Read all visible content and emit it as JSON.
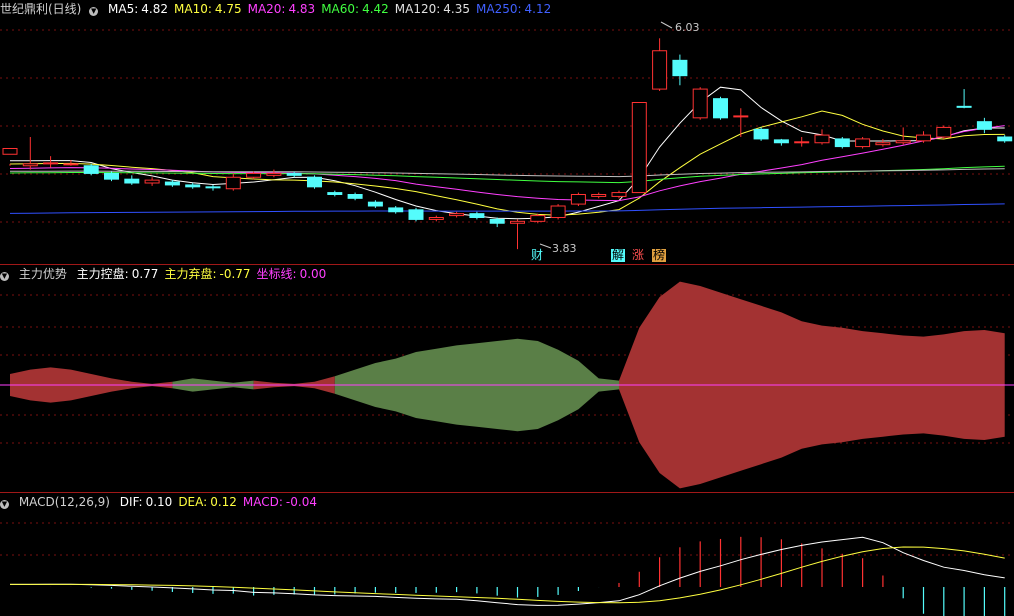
{
  "main_panel": {
    "title": "世纪鼎利(日线)",
    "ma": [
      {
        "label": "MA5:",
        "value": "4.82",
        "color": "#ffffff"
      },
      {
        "label": "MA10:",
        "value": "4.75",
        "color": "#ffff40"
      },
      {
        "label": "MA20:",
        "value": "4.83",
        "color": "#ff40ff"
      },
      {
        "label": "MA60:",
        "value": "4.42",
        "color": "#40ff40"
      },
      {
        "label": "MA120:",
        "value": "4.35",
        "color": "#e0e0e0"
      },
      {
        "label": "MA250:",
        "value": "4.12",
        "color": "#4060ff"
      }
    ],
    "high_label": "6.03",
    "low_label": "3.83",
    "markers": [
      "财",
      "解",
      "涨",
      "榜"
    ]
  },
  "indicator_panel": {
    "name": "主力优势",
    "items": [
      {
        "label": "主力控盘:",
        "value": "0.77",
        "color": "#ffffff"
      },
      {
        "label": "主力弃盘:",
        "value": "-0.77",
        "color": "#ffff40"
      },
      {
        "label": "坐标线:",
        "value": "0.00",
        "color": "#ff40ff"
      }
    ]
  },
  "macd_panel": {
    "name": "MACD(12,26,9)",
    "items": [
      {
        "label": "DIF:",
        "value": "0.10",
        "color": "#ffffff"
      },
      {
        "label": "DEA:",
        "value": "0.12",
        "color": "#ffff40"
      },
      {
        "label": "MACD:",
        "value": "-0.04",
        "color": "#ff40ff"
      }
    ]
  },
  "colors": {
    "up": "#ff3232",
    "down": "#54fcfc",
    "grid": "#7a1010",
    "frame": "#a01818",
    "red_fill": "#a33232",
    "green_fill": "#5a7f47"
  },
  "chart_data": {
    "type": "candlestick",
    "ohlc": [
      [
        4.82,
        4.88,
        4.72,
        4.7
      ],
      [
        4.7,
        4.72,
        5.0,
        4.66
      ],
      [
        4.72,
        4.73,
        4.8,
        4.68
      ],
      [
        4.72,
        4.72,
        4.76,
        4.7
      ],
      [
        4.7,
        4.62,
        4.72,
        4.6
      ],
      [
        4.62,
        4.56,
        4.64,
        4.54
      ],
      [
        4.56,
        4.52,
        4.6,
        4.5
      ],
      [
        4.52,
        4.55,
        4.58,
        4.49
      ],
      [
        4.53,
        4.5,
        4.55,
        4.48
      ],
      [
        4.5,
        4.48,
        4.52,
        4.46
      ],
      [
        4.48,
        4.47,
        4.5,
        4.44
      ],
      [
        4.46,
        4.58,
        4.62,
        4.44
      ],
      [
        4.58,
        4.62,
        4.64,
        4.56
      ],
      [
        4.6,
        4.62,
        4.66,
        4.58
      ],
      [
        4.62,
        4.6,
        4.64,
        4.58
      ],
      [
        4.58,
        4.48,
        4.6,
        4.46
      ],
      [
        4.42,
        4.4,
        4.44,
        4.38
      ],
      [
        4.4,
        4.36,
        4.42,
        4.34
      ],
      [
        4.32,
        4.28,
        4.34,
        4.26
      ],
      [
        4.26,
        4.22,
        4.28,
        4.2
      ],
      [
        4.24,
        4.14,
        4.26,
        4.12
      ],
      [
        4.14,
        4.16,
        4.18,
        4.12
      ],
      [
        4.18,
        4.2,
        4.22,
        4.16
      ],
      [
        4.2,
        4.16,
        4.22,
        4.14
      ],
      [
        4.14,
        4.1,
        4.16,
        4.06
      ],
      [
        4.1,
        4.12,
        4.14,
        3.83
      ],
      [
        4.12,
        4.18,
        4.2,
        4.1
      ],
      [
        4.16,
        4.28,
        4.3,
        4.14
      ],
      [
        4.3,
        4.4,
        4.42,
        4.28
      ],
      [
        4.38,
        4.4,
        4.42,
        4.36
      ],
      [
        4.38,
        4.42,
        4.44,
        4.36
      ],
      [
        4.42,
        5.36,
        5.36,
        4.42
      ],
      [
        5.5,
        5.9,
        6.03,
        5.48
      ],
      [
        5.8,
        5.64,
        5.86,
        5.54
      ],
      [
        5.2,
        5.5,
        5.52,
        5.18
      ],
      [
        5.4,
        5.2,
        5.42,
        5.18
      ],
      [
        5.22,
        5.22,
        5.3,
        5.0
      ],
      [
        5.08,
        4.98,
        5.1,
        4.96
      ],
      [
        4.97,
        4.94,
        4.98,
        4.91
      ],
      [
        4.95,
        4.95,
        5.0,
        4.9
      ],
      [
        4.94,
        5.02,
        5.08,
        4.92
      ],
      [
        4.98,
        4.9,
        5.0,
        4.88
      ],
      [
        4.9,
        4.98,
        5.0,
        4.88
      ],
      [
        4.92,
        4.94,
        4.98,
        4.9
      ],
      [
        4.94,
        4.96,
        5.1,
        4.92
      ],
      [
        4.96,
        5.02,
        5.06,
        4.94
      ],
      [
        5.0,
        5.1,
        5.12,
        4.98
      ],
      [
        5.32,
        5.31,
        5.5,
        5.3
      ],
      [
        5.16,
        5.08,
        5.2,
        5.04
      ],
      [
        5.0,
        4.96,
        5.02,
        4.94
      ]
    ],
    "y_range": [
      3.8,
      6.2
    ]
  }
}
